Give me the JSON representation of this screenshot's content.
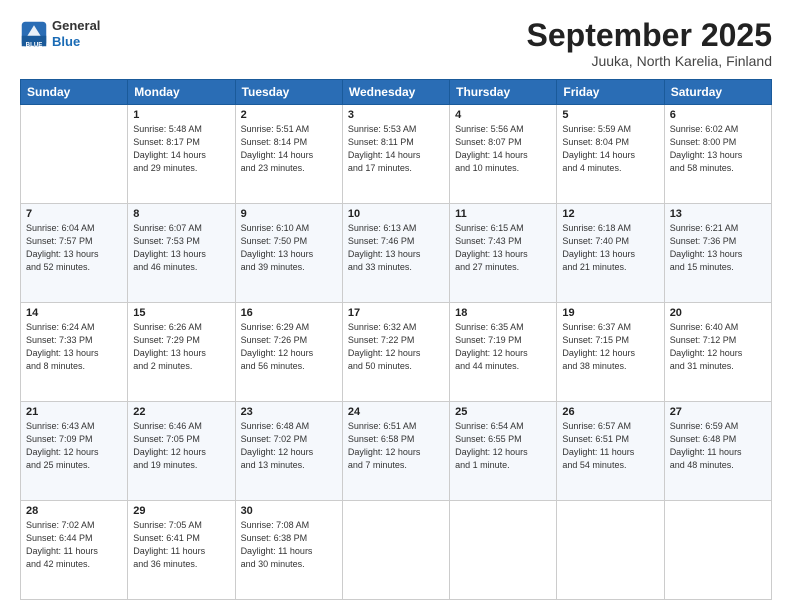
{
  "header": {
    "logo_line1": "General",
    "logo_line2": "Blue",
    "month": "September 2025",
    "location": "Juuka, North Karelia, Finland"
  },
  "weekdays": [
    "Sunday",
    "Monday",
    "Tuesday",
    "Wednesday",
    "Thursday",
    "Friday",
    "Saturday"
  ],
  "weeks": [
    [
      {
        "day": "",
        "info": ""
      },
      {
        "day": "1",
        "info": "Sunrise: 5:48 AM\nSunset: 8:17 PM\nDaylight: 14 hours\nand 29 minutes."
      },
      {
        "day": "2",
        "info": "Sunrise: 5:51 AM\nSunset: 8:14 PM\nDaylight: 14 hours\nand 23 minutes."
      },
      {
        "day": "3",
        "info": "Sunrise: 5:53 AM\nSunset: 8:11 PM\nDaylight: 14 hours\nand 17 minutes."
      },
      {
        "day": "4",
        "info": "Sunrise: 5:56 AM\nSunset: 8:07 PM\nDaylight: 14 hours\nand 10 minutes."
      },
      {
        "day": "5",
        "info": "Sunrise: 5:59 AM\nSunset: 8:04 PM\nDaylight: 14 hours\nand 4 minutes."
      },
      {
        "day": "6",
        "info": "Sunrise: 6:02 AM\nSunset: 8:00 PM\nDaylight: 13 hours\nand 58 minutes."
      }
    ],
    [
      {
        "day": "7",
        "info": "Sunrise: 6:04 AM\nSunset: 7:57 PM\nDaylight: 13 hours\nand 52 minutes."
      },
      {
        "day": "8",
        "info": "Sunrise: 6:07 AM\nSunset: 7:53 PM\nDaylight: 13 hours\nand 46 minutes."
      },
      {
        "day": "9",
        "info": "Sunrise: 6:10 AM\nSunset: 7:50 PM\nDaylight: 13 hours\nand 39 minutes."
      },
      {
        "day": "10",
        "info": "Sunrise: 6:13 AM\nSunset: 7:46 PM\nDaylight: 13 hours\nand 33 minutes."
      },
      {
        "day": "11",
        "info": "Sunrise: 6:15 AM\nSunset: 7:43 PM\nDaylight: 13 hours\nand 27 minutes."
      },
      {
        "day": "12",
        "info": "Sunrise: 6:18 AM\nSunset: 7:40 PM\nDaylight: 13 hours\nand 21 minutes."
      },
      {
        "day": "13",
        "info": "Sunrise: 6:21 AM\nSunset: 7:36 PM\nDaylight: 13 hours\nand 15 minutes."
      }
    ],
    [
      {
        "day": "14",
        "info": "Sunrise: 6:24 AM\nSunset: 7:33 PM\nDaylight: 13 hours\nand 8 minutes."
      },
      {
        "day": "15",
        "info": "Sunrise: 6:26 AM\nSunset: 7:29 PM\nDaylight: 13 hours\nand 2 minutes."
      },
      {
        "day": "16",
        "info": "Sunrise: 6:29 AM\nSunset: 7:26 PM\nDaylight: 12 hours\nand 56 minutes."
      },
      {
        "day": "17",
        "info": "Sunrise: 6:32 AM\nSunset: 7:22 PM\nDaylight: 12 hours\nand 50 minutes."
      },
      {
        "day": "18",
        "info": "Sunrise: 6:35 AM\nSunset: 7:19 PM\nDaylight: 12 hours\nand 44 minutes."
      },
      {
        "day": "19",
        "info": "Sunrise: 6:37 AM\nSunset: 7:15 PM\nDaylight: 12 hours\nand 38 minutes."
      },
      {
        "day": "20",
        "info": "Sunrise: 6:40 AM\nSunset: 7:12 PM\nDaylight: 12 hours\nand 31 minutes."
      }
    ],
    [
      {
        "day": "21",
        "info": "Sunrise: 6:43 AM\nSunset: 7:09 PM\nDaylight: 12 hours\nand 25 minutes."
      },
      {
        "day": "22",
        "info": "Sunrise: 6:46 AM\nSunset: 7:05 PM\nDaylight: 12 hours\nand 19 minutes."
      },
      {
        "day": "23",
        "info": "Sunrise: 6:48 AM\nSunset: 7:02 PM\nDaylight: 12 hours\nand 13 minutes."
      },
      {
        "day": "24",
        "info": "Sunrise: 6:51 AM\nSunset: 6:58 PM\nDaylight: 12 hours\nand 7 minutes."
      },
      {
        "day": "25",
        "info": "Sunrise: 6:54 AM\nSunset: 6:55 PM\nDaylight: 12 hours\nand 1 minute."
      },
      {
        "day": "26",
        "info": "Sunrise: 6:57 AM\nSunset: 6:51 PM\nDaylight: 11 hours\nand 54 minutes."
      },
      {
        "day": "27",
        "info": "Sunrise: 6:59 AM\nSunset: 6:48 PM\nDaylight: 11 hours\nand 48 minutes."
      }
    ],
    [
      {
        "day": "28",
        "info": "Sunrise: 7:02 AM\nSunset: 6:44 PM\nDaylight: 11 hours\nand 42 minutes."
      },
      {
        "day": "29",
        "info": "Sunrise: 7:05 AM\nSunset: 6:41 PM\nDaylight: 11 hours\nand 36 minutes."
      },
      {
        "day": "30",
        "info": "Sunrise: 7:08 AM\nSunset: 6:38 PM\nDaylight: 11 hours\nand 30 minutes."
      },
      {
        "day": "",
        "info": ""
      },
      {
        "day": "",
        "info": ""
      },
      {
        "day": "",
        "info": ""
      },
      {
        "day": "",
        "info": ""
      }
    ]
  ]
}
